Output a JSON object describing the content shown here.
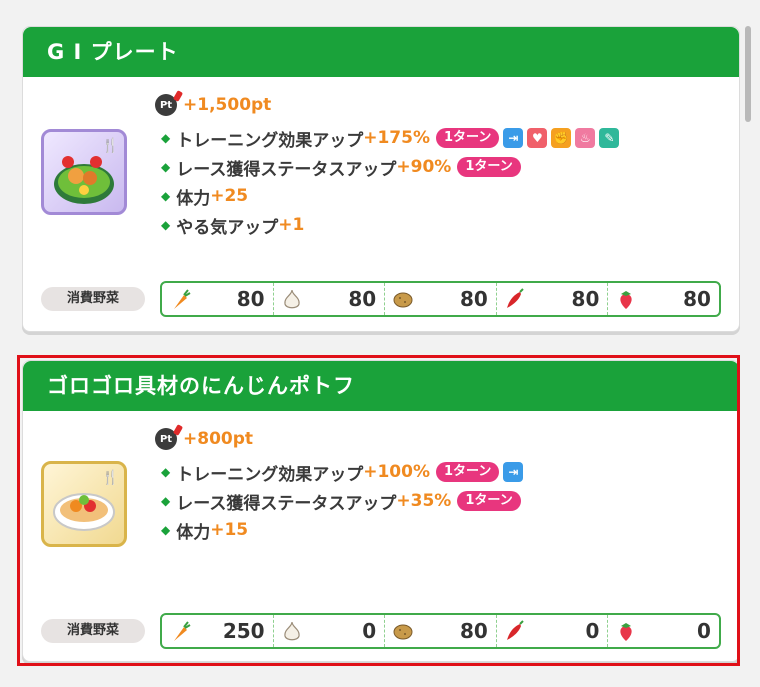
{
  "cards": [
    {
      "title": "G I プレート",
      "points": "+1,500pt",
      "effects": [
        {
          "label": "トレーニング効果アップ",
          "value": "+175%",
          "turn": "1ターン"
        },
        {
          "label": "レース獲得ステータスアップ",
          "value": "+90%",
          "turn": "1ターン"
        },
        {
          "label": "体力",
          "value": "+25"
        },
        {
          "label": "やる気アップ",
          "value": "+1"
        }
      ],
      "stat_icons": [
        "speed-icon",
        "stamina-icon",
        "power-icon",
        "guts-icon",
        "wisdom-icon"
      ],
      "veg_label": "消費野菜",
      "vegetables": [
        "80",
        "80",
        "80",
        "80",
        "80"
      ]
    },
    {
      "title": "ゴロゴロ具材のにんじんポトフ",
      "points": "+800pt",
      "effects": [
        {
          "label": "トレーニング効果アップ",
          "value": "+100%",
          "turn": "1ターン"
        },
        {
          "label": "レース獲得ステータスアップ",
          "value": "+35%",
          "turn": "1ターン"
        },
        {
          "label": "体力",
          "value": "+15"
        }
      ],
      "stat_icons": [
        "speed-icon"
      ],
      "veg_label": "消費野菜",
      "vegetables": [
        "250",
        "0",
        "80",
        "0",
        "0"
      ]
    }
  ],
  "vegetable_icons": [
    "carrot-icon",
    "garlic-icon",
    "potato-icon",
    "pepper-icon",
    "strawberry-icon"
  ],
  "pt_icon_text": "Pt",
  "colors": {
    "header": "#1aa23a",
    "accent": "#f08a20",
    "badge": "#e8367e",
    "highlight": "#e01018"
  }
}
